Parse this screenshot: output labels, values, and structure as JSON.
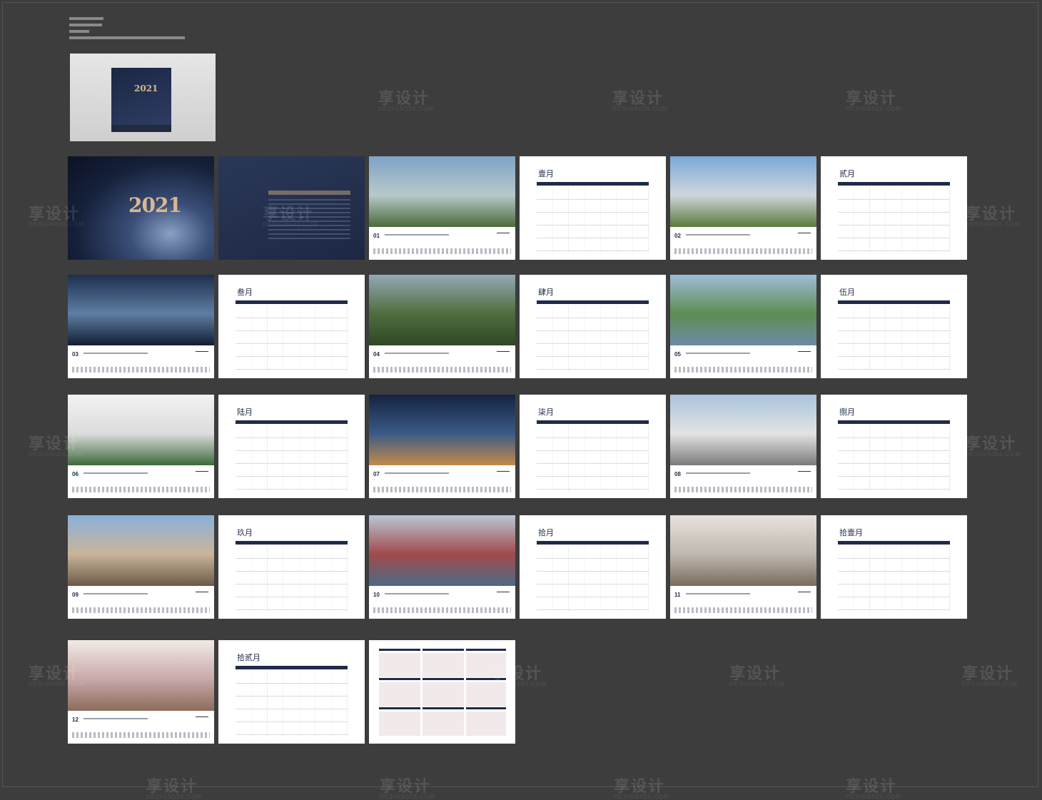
{
  "mockup": {
    "cover_year": "2021"
  },
  "cover": {
    "year": "2021"
  },
  "photo_pages": [
    {
      "num": "01",
      "colors": [
        "#7fa3c7",
        "#b7c9c9",
        "#4a6b3a"
      ]
    },
    {
      "num": "02",
      "colors": [
        "#79a9d8",
        "#cfd6dc",
        "#5a7a3b"
      ]
    },
    {
      "num": "03",
      "colors": [
        "#1c2f4d",
        "#5e7ea3",
        "#121e33"
      ]
    },
    {
      "num": "04",
      "colors": [
        "#93a9b5",
        "#4f6d3e",
        "#2f4725"
      ]
    },
    {
      "num": "05",
      "colors": [
        "#9fbcd9",
        "#5d8d52",
        "#6e8aa6"
      ]
    },
    {
      "num": "06",
      "colors": [
        "#f2f2f2",
        "#dcdcdc",
        "#3d6a3a"
      ]
    },
    {
      "num": "07",
      "colors": [
        "#14233f",
        "#3a5a86",
        "#c48a4a"
      ]
    },
    {
      "num": "08",
      "colors": [
        "#a9c4dc",
        "#e3e3e3",
        "#7b7b7b"
      ]
    },
    {
      "num": "09",
      "colors": [
        "#8ab0da",
        "#c9b59a",
        "#6b5a48"
      ]
    },
    {
      "num": "10",
      "colors": [
        "#b9c7d5",
        "#a14a4a",
        "#4b6a86"
      ]
    },
    {
      "num": "11",
      "colors": [
        "#e6e2dc",
        "#bfb8ae",
        "#7a6c5e"
      ]
    },
    {
      "num": "12",
      "colors": [
        "#f0ebe6",
        "#c9a9a9",
        "#8c6c5c"
      ]
    }
  ],
  "calendar_pages": [
    {
      "title": "壹月"
    },
    {
      "title": "贰月"
    },
    {
      "title": "叁月"
    },
    {
      "title": "肆月"
    },
    {
      "title": "伍月"
    },
    {
      "title": "陆月"
    },
    {
      "title": "柒月"
    },
    {
      "title": "捌月"
    },
    {
      "title": "玖月"
    },
    {
      "title": "拾月"
    },
    {
      "title": "拾壹月"
    },
    {
      "title": "拾贰月"
    }
  ],
  "watermark": {
    "text": "享设计",
    "sub": "DESIGN006.COM"
  }
}
